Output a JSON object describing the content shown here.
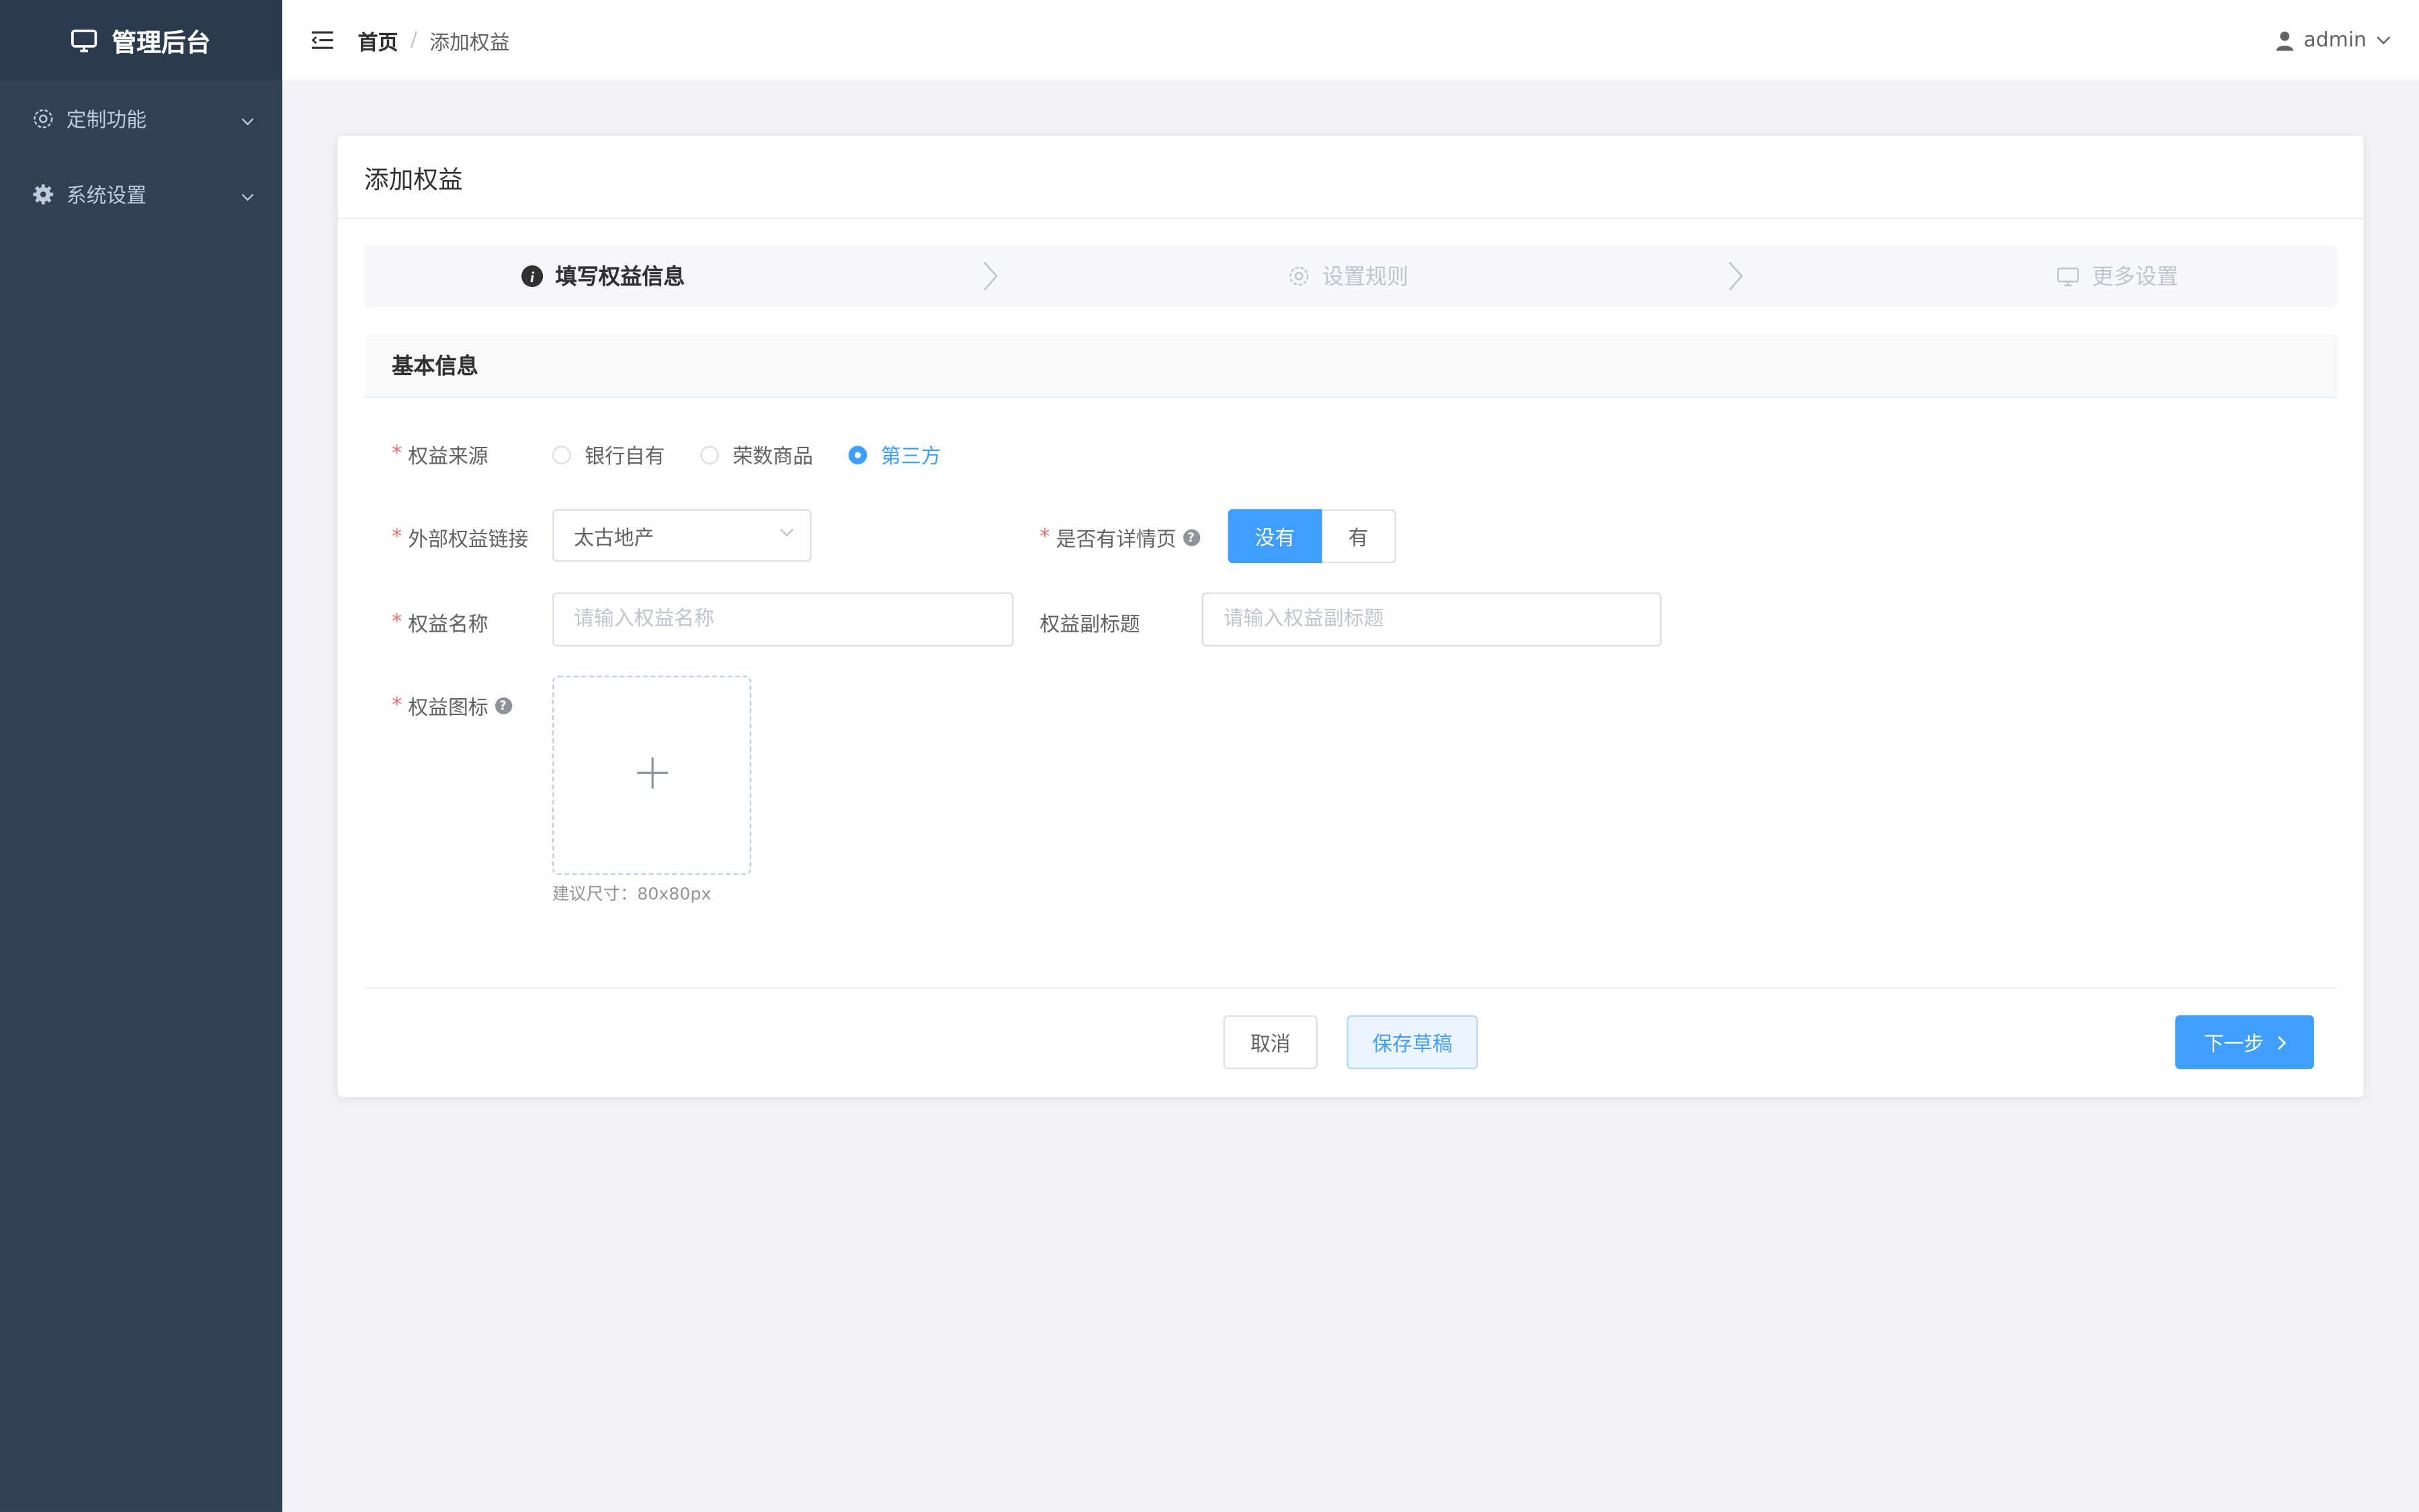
{
  "sidebar": {
    "brand": "管理后台",
    "items": [
      {
        "label": "定制功能",
        "icon": "gear-outline-icon"
      },
      {
        "label": "系统设置",
        "icon": "gear-solid-icon"
      }
    ]
  },
  "header": {
    "breadcrumb": {
      "home": "首页",
      "separator": "/",
      "current": "添加权益"
    },
    "user": "admin"
  },
  "card": {
    "title": "添加权益",
    "steps": [
      {
        "label": "填写权益信息",
        "icon": "info-icon",
        "active": true
      },
      {
        "label": "设置规则",
        "icon": "gear-icon",
        "active": false
      },
      {
        "label": "更多设置",
        "icon": "monitor-icon",
        "active": false
      }
    ],
    "section_title": "基本信息",
    "form": {
      "source": {
        "label": "权益来源",
        "options": [
          "银行自有",
          "荣数商品",
          "第三方"
        ],
        "selected": "第三方"
      },
      "external_link": {
        "label": "外部权益链接",
        "value": "太古地产"
      },
      "has_detail": {
        "label": "是否有详情页",
        "options": [
          "没有",
          "有"
        ],
        "selected": "没有"
      },
      "name": {
        "label": "权益名称",
        "placeholder": "请输入权益名称"
      },
      "subtitle": {
        "label": "权益副标题",
        "placeholder": "请输入权益副标题"
      },
      "icon_upload": {
        "label": "权益图标",
        "hint": "建议尺寸：80x80px"
      }
    },
    "buttons": {
      "cancel": "取消",
      "draft": "保存草稿",
      "next": "下一步"
    }
  },
  "colors": {
    "sidebar": "#304156",
    "sidebar_brand": "#2b3a4c",
    "primary": "#409eff",
    "required": "#f56c6c",
    "background": "#f0f2f5"
  }
}
